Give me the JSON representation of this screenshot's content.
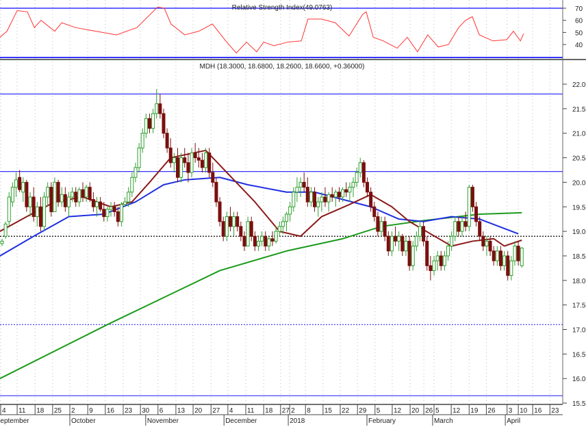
{
  "chart_data": {
    "type": "candlestick",
    "ticker": "MDH",
    "title": "MDH (18.3000, 18.6800, 18.2600, 18.6600, +0.36000)",
    "rsi_title": "Relative Strength Index(49.0763)",
    "ylim": [
      15.5,
      22.0
    ],
    "yticks": [
      "15.5",
      "16.0",
      "16.5",
      "17.0",
      "17.5",
      "18.0",
      "18.5",
      "19.0",
      "19.5",
      "20.0",
      "20.5",
      "21.0",
      "21.5",
      "22.0"
    ],
    "rsi_ylim": [
      30,
      70
    ],
    "rsi_yticks": [
      "40",
      "50",
      "60",
      "70"
    ],
    "rsi_levels": [
      70,
      30
    ],
    "horizontal_lines": [
      {
        "value": 21.8,
        "style": "solid",
        "color": "#3333ff"
      },
      {
        "value": 20.22,
        "style": "solid",
        "color": "#3333ff"
      },
      {
        "value": 17.1,
        "style": "dotted",
        "color": "#3333ff"
      },
      {
        "value": 15.65,
        "style": "solid",
        "color": "#3333ff"
      },
      {
        "value": 18.9,
        "style": "dotted",
        "color": "#000000"
      }
    ],
    "colors": {
      "up": "#2e9e2e",
      "down": "#7a0f0f",
      "ma20": "#8b1a1a",
      "ma50": "#1f2fe0",
      "ma200": "#1a9a1a",
      "rsi": "#ff3333",
      "level": "#3333ff"
    },
    "candles_ohlc": [
      [
        18.75,
        18.85,
        18.7,
        18.8
      ],
      [
        18.9,
        19.2,
        18.85,
        19.15
      ],
      [
        19.2,
        19.8,
        19.1,
        19.7
      ],
      [
        19.6,
        20.0,
        19.5,
        19.9
      ],
      [
        19.9,
        20.2,
        19.7,
        20.05
      ],
      [
        20.1,
        20.25,
        19.8,
        19.85
      ],
      [
        19.8,
        20.1,
        19.6,
        20.0
      ],
      [
        20.0,
        20.05,
        19.4,
        19.5
      ],
      [
        19.5,
        19.8,
        19.3,
        19.7
      ],
      [
        19.7,
        19.9,
        19.2,
        19.3
      ],
      [
        19.3,
        19.6,
        19.1,
        19.5
      ],
      [
        19.5,
        19.7,
        19.0,
        19.1
      ],
      [
        19.1,
        19.8,
        19.0,
        19.7
      ],
      [
        19.7,
        20.0,
        19.5,
        19.9
      ],
      [
        19.9,
        20.0,
        19.3,
        19.4
      ],
      [
        19.4,
        20.1,
        19.4,
        20.0
      ],
      [
        20.0,
        20.05,
        19.5,
        19.6
      ],
      [
        19.6,
        19.9,
        19.5,
        19.75
      ],
      [
        19.75,
        19.9,
        19.4,
        19.5
      ],
      [
        19.5,
        19.8,
        19.3,
        19.7
      ],
      [
        19.7,
        19.9,
        19.6,
        19.8
      ],
      [
        19.8,
        19.9,
        19.5,
        19.6
      ],
      [
        19.6,
        19.9,
        19.5,
        19.85
      ],
      [
        19.85,
        20.0,
        19.6,
        19.7
      ],
      [
        19.7,
        19.95,
        19.6,
        19.9
      ],
      [
        19.9,
        20.0,
        19.6,
        19.65
      ],
      [
        19.65,
        19.8,
        19.4,
        19.5
      ],
      [
        19.5,
        19.7,
        19.3,
        19.6
      ],
      [
        19.6,
        19.7,
        19.4,
        19.45
      ],
      [
        19.45,
        19.6,
        19.2,
        19.3
      ],
      [
        19.3,
        19.5,
        19.2,
        19.45
      ],
      [
        19.45,
        19.6,
        19.3,
        19.5
      ],
      [
        19.5,
        19.6,
        19.3,
        19.4
      ],
      [
        19.4,
        19.5,
        19.1,
        19.2
      ],
      [
        19.2,
        19.6,
        19.1,
        19.55
      ],
      [
        19.55,
        19.7,
        19.5,
        19.6
      ],
      [
        19.6,
        19.9,
        19.5,
        19.8
      ],
      [
        19.8,
        20.2,
        19.7,
        20.1
      ],
      [
        20.1,
        20.4,
        20.0,
        20.3
      ],
      [
        20.3,
        20.8,
        20.2,
        20.7
      ],
      [
        20.7,
        21.1,
        20.6,
        21.0
      ],
      [
        21.0,
        21.4,
        20.9,
        21.3
      ],
      [
        21.3,
        21.4,
        21.0,
        21.1
      ],
      [
        21.1,
        21.5,
        21.0,
        21.4
      ],
      [
        21.4,
        21.9,
        21.3,
        21.6
      ],
      [
        21.6,
        21.8,
        21.3,
        21.4
      ],
      [
        21.4,
        21.5,
        20.9,
        21.0
      ],
      [
        21.0,
        21.1,
        20.6,
        20.7
      ],
      [
        20.7,
        20.9,
        20.3,
        20.4
      ],
      [
        20.4,
        20.6,
        20.2,
        20.5
      ],
      [
        20.5,
        20.7,
        20.0,
        20.1
      ],
      [
        20.1,
        20.6,
        20.0,
        20.5
      ],
      [
        20.5,
        20.7,
        20.3,
        20.4
      ],
      [
        20.4,
        20.6,
        20.0,
        20.2
      ],
      [
        20.2,
        20.7,
        20.1,
        20.6
      ],
      [
        20.6,
        20.8,
        20.4,
        20.5
      ],
      [
        20.5,
        20.7,
        20.3,
        20.45
      ],
      [
        20.45,
        20.6,
        20.2,
        20.3
      ],
      [
        20.3,
        20.7,
        20.2,
        20.6
      ],
      [
        20.6,
        20.7,
        20.1,
        20.2
      ],
      [
        20.2,
        20.4,
        19.9,
        20.0
      ],
      [
        20.0,
        20.1,
        19.5,
        19.6
      ],
      [
        19.6,
        19.7,
        19.1,
        19.2
      ],
      [
        19.2,
        19.3,
        18.8,
        18.9
      ],
      [
        18.9,
        19.4,
        18.8,
        19.3
      ],
      [
        19.3,
        19.5,
        19.0,
        19.1
      ],
      [
        19.1,
        19.4,
        18.9,
        19.3
      ],
      [
        19.3,
        19.4,
        19.0,
        19.1
      ],
      [
        19.1,
        19.2,
        18.8,
        18.9
      ],
      [
        18.9,
        19.0,
        18.6,
        18.7
      ],
      [
        18.7,
        19.3,
        18.7,
        19.2
      ],
      [
        19.2,
        19.3,
        18.8,
        18.9
      ],
      [
        18.9,
        19.0,
        18.6,
        18.7
      ],
      [
        18.7,
        18.9,
        18.6,
        18.8
      ],
      [
        18.8,
        19.0,
        18.7,
        18.9
      ],
      [
        18.9,
        19.0,
        18.6,
        18.7
      ],
      [
        18.7,
        18.9,
        18.6,
        18.85
      ],
      [
        18.85,
        19.0,
        18.7,
        18.8
      ],
      [
        18.8,
        19.1,
        18.75,
        19.0
      ],
      [
        19.0,
        19.2,
        18.9,
        19.1
      ],
      [
        19.1,
        19.3,
        18.95,
        19.2
      ],
      [
        19.2,
        19.4,
        19.0,
        19.35
      ],
      [
        19.35,
        19.6,
        19.2,
        19.5
      ],
      [
        19.5,
        19.9,
        19.4,
        19.8
      ],
      [
        19.8,
        20.1,
        19.6,
        19.9
      ],
      [
        19.9,
        20.1,
        19.7,
        20.0
      ],
      [
        20.0,
        20.2,
        19.8,
        19.9
      ],
      [
        19.9,
        20.1,
        19.5,
        19.6
      ],
      [
        19.6,
        19.9,
        19.5,
        19.8
      ],
      [
        19.8,
        19.9,
        19.4,
        19.5
      ],
      [
        19.5,
        19.7,
        19.3,
        19.6
      ],
      [
        19.6,
        19.8,
        19.4,
        19.7
      ],
      [
        19.7,
        19.9,
        19.5,
        19.6
      ],
      [
        19.6,
        19.8,
        19.4,
        19.75
      ],
      [
        19.75,
        19.9,
        19.6,
        19.7
      ],
      [
        19.7,
        19.85,
        19.5,
        19.8
      ],
      [
        19.8,
        19.9,
        19.6,
        19.7
      ],
      [
        19.7,
        19.9,
        19.6,
        19.85
      ],
      [
        19.85,
        20.0,
        19.7,
        19.8
      ],
      [
        19.8,
        20.0,
        19.6,
        19.9
      ],
      [
        19.9,
        20.1,
        19.7,
        20.0
      ],
      [
        20.0,
        20.3,
        19.9,
        20.2
      ],
      [
        20.2,
        20.5,
        20.1,
        20.4
      ],
      [
        20.4,
        20.45,
        19.9,
        20.0
      ],
      [
        20.0,
        20.1,
        19.7,
        19.8
      ],
      [
        19.8,
        19.9,
        19.4,
        19.5
      ],
      [
        19.5,
        19.6,
        19.2,
        19.3
      ],
      [
        19.3,
        19.4,
        18.9,
        19.0
      ],
      [
        19.0,
        19.3,
        18.9,
        19.2
      ],
      [
        19.2,
        19.3,
        18.8,
        18.9
      ],
      [
        18.9,
        19.0,
        18.5,
        18.6
      ],
      [
        18.6,
        19.0,
        18.5,
        18.9
      ],
      [
        18.9,
        19.1,
        18.7,
        18.8
      ],
      [
        18.8,
        19.0,
        18.6,
        18.9
      ],
      [
        18.9,
        18.95,
        18.5,
        18.6
      ],
      [
        18.6,
        18.9,
        18.5,
        18.8
      ],
      [
        18.8,
        18.9,
        18.2,
        18.3
      ],
      [
        18.3,
        18.8,
        18.2,
        18.7
      ],
      [
        18.7,
        19.0,
        18.6,
        18.9
      ],
      [
        18.9,
        19.2,
        18.8,
        19.1
      ],
      [
        19.1,
        19.2,
        18.7,
        18.8
      ],
      [
        18.8,
        18.9,
        18.2,
        18.3
      ],
      [
        18.3,
        18.5,
        18.0,
        18.2
      ],
      [
        18.2,
        18.5,
        18.1,
        18.4
      ],
      [
        18.4,
        18.6,
        18.2,
        18.5
      ],
      [
        18.5,
        18.6,
        18.2,
        18.3
      ],
      [
        18.3,
        18.6,
        18.2,
        18.5
      ],
      [
        18.5,
        18.8,
        18.4,
        18.7
      ],
      [
        18.7,
        19.0,
        18.6,
        18.9
      ],
      [
        18.9,
        19.3,
        18.8,
        19.2
      ],
      [
        19.2,
        19.3,
        18.9,
        19.0
      ],
      [
        19.0,
        19.3,
        18.9,
        19.2
      ],
      [
        19.2,
        19.4,
        19.0,
        19.1
      ],
      [
        19.1,
        19.95,
        19.0,
        19.9
      ],
      [
        19.9,
        19.95,
        19.4,
        19.5
      ],
      [
        19.5,
        19.6,
        19.1,
        19.2
      ],
      [
        19.2,
        19.3,
        18.8,
        18.9
      ],
      [
        18.9,
        19.0,
        18.6,
        18.7
      ],
      [
        18.7,
        18.9,
        18.5,
        18.8
      ],
      [
        18.8,
        18.9,
        18.5,
        18.6
      ],
      [
        18.6,
        18.7,
        18.3,
        18.4
      ],
      [
        18.4,
        18.7,
        18.3,
        18.6
      ],
      [
        18.6,
        18.7,
        18.2,
        18.3
      ],
      [
        18.3,
        18.6,
        18.2,
        18.5
      ],
      [
        18.5,
        18.6,
        18.0,
        18.1
      ],
      [
        18.1,
        18.5,
        18.0,
        18.4
      ],
      [
        18.4,
        18.8,
        18.3,
        18.7
      ],
      [
        18.7,
        18.8,
        18.3,
        18.4
      ],
      [
        18.3,
        18.68,
        18.26,
        18.66
      ]
    ],
    "ma200": [
      [
        -0.6,
        16.0
      ],
      [
        30,
        17.1
      ],
      [
        62,
        18.2
      ],
      [
        81,
        18.6
      ],
      [
        97,
        18.85
      ],
      [
        108,
        19.1
      ],
      [
        120,
        19.22
      ],
      [
        136,
        19.35
      ],
      [
        148,
        19.38
      ]
    ],
    "ma50": [
      [
        -0.6,
        18.5
      ],
      [
        9,
        18.9
      ],
      [
        19,
        19.3
      ],
      [
        29,
        19.35
      ],
      [
        38,
        19.6
      ],
      [
        46,
        19.95
      ],
      [
        52,
        20.05
      ],
      [
        62,
        20.1
      ],
      [
        70,
        19.95
      ],
      [
        81,
        19.8
      ],
      [
        89,
        19.8
      ],
      [
        97,
        19.65
      ],
      [
        105,
        19.5
      ],
      [
        113,
        19.25
      ],
      [
        120,
        19.2
      ],
      [
        128,
        19.3
      ],
      [
        136,
        19.25
      ],
      [
        147,
        18.95
      ]
    ],
    "ma20": [
      [
        -0.6,
        19.0
      ],
      [
        7,
        19.3
      ],
      [
        15,
        19.6
      ],
      [
        23,
        19.7
      ],
      [
        31,
        19.5
      ],
      [
        37,
        19.6
      ],
      [
        42,
        20.0
      ],
      [
        48,
        20.5
      ],
      [
        58,
        20.65
      ],
      [
        64,
        20.2
      ],
      [
        72,
        19.6
      ],
      [
        79,
        19.0
      ],
      [
        85,
        18.9
      ],
      [
        91,
        19.3
      ],
      [
        99,
        19.55
      ],
      [
        105,
        19.75
      ],
      [
        111,
        19.5
      ],
      [
        116,
        19.2
      ],
      [
        122,
        18.95
      ],
      [
        128,
        18.7
      ],
      [
        134,
        18.8
      ],
      [
        140,
        18.85
      ],
      [
        143,
        18.7
      ],
      [
        148,
        18.82
      ]
    ],
    "rsi": [
      [
        -0.6,
        46
      ],
      [
        1.4,
        51
      ],
      [
        4.3,
        68
      ],
      [
        7.2,
        67
      ],
      [
        9.2,
        54
      ],
      [
        11.1,
        60
      ],
      [
        15,
        51
      ],
      [
        17,
        58
      ],
      [
        20.9,
        54
      ],
      [
        26.7,
        51
      ],
      [
        32.6,
        48
      ],
      [
        38.4,
        54
      ],
      [
        44.3,
        71
      ],
      [
        46.2,
        70
      ],
      [
        48.1,
        57
      ],
      [
        52,
        48
      ],
      [
        56,
        51
      ],
      [
        59.9,
        57
      ],
      [
        63.7,
        43
      ],
      [
        66.7,
        33
      ],
      [
        69.6,
        42
      ],
      [
        72.5,
        34
      ],
      [
        74.5,
        42
      ],
      [
        77.4,
        39
      ],
      [
        81.3,
        42
      ],
      [
        85.2,
        43
      ],
      [
        87.1,
        61
      ],
      [
        91,
        61
      ],
      [
        94.9,
        58
      ],
      [
        98.8,
        47
      ],
      [
        102.7,
        65
      ],
      [
        103.7,
        67
      ],
      [
        105.7,
        46
      ],
      [
        108.6,
        43
      ],
      [
        112.5,
        37
      ],
      [
        115.4,
        46
      ],
      [
        118.3,
        34
      ],
      [
        121.2,
        48
      ],
      [
        124.2,
        38
      ],
      [
        127.1,
        40
      ],
      [
        130,
        54
      ],
      [
        132,
        60
      ],
      [
        133.9,
        63
      ],
      [
        135.9,
        48
      ],
      [
        139.8,
        43
      ],
      [
        143.7,
        44
      ],
      [
        145.6,
        51
      ],
      [
        147.6,
        43
      ],
      [
        148.5,
        49
      ]
    ],
    "x_ticks": [
      {
        "label": "4",
        "idx": -0.4
      },
      {
        "label": "11",
        "idx": 4.3
      },
      {
        "label": "18",
        "idx": 9.4
      },
      {
        "label": "25",
        "idx": 14.4
      },
      {
        "label": "2",
        "idx": 19.3
      },
      {
        "label": "9",
        "idx": 24.4
      },
      {
        "label": "16",
        "idx": 29.4
      },
      {
        "label": "23",
        "idx": 34.5
      },
      {
        "label": "30",
        "idx": 39.4
      },
      {
        "label": "6",
        "idx": 44.4
      },
      {
        "label": "13",
        "idx": 49.5
      },
      {
        "label": "20",
        "idx": 54.4
      },
      {
        "label": "27",
        "idx": 59.5
      },
      {
        "label": "4",
        "idx": 64.3
      },
      {
        "label": "11",
        "idx": 69.4
      },
      {
        "label": "18",
        "idx": 74.5
      },
      {
        "label": "27",
        "idx": 79.3
      },
      {
        "label": "2",
        "idx": 81.9
      },
      {
        "label": "8",
        "idx": 86.4
      },
      {
        "label": "15",
        "idx": 91.4
      },
      {
        "label": "22",
        "idx": 96.3
      },
      {
        "label": "29",
        "idx": 101.2
      },
      {
        "label": "5",
        "idx": 106.2
      },
      {
        "label": "12",
        "idx": 111.1
      },
      {
        "label": "20",
        "idx": 116.2
      },
      {
        "label": "26",
        "idx": 120.1
      },
      {
        "label": "5",
        "idx": 123.0
      },
      {
        "label": "12",
        "idx": 127.9
      },
      {
        "label": "19",
        "idx": 133.0
      },
      {
        "label": "26",
        "idx": 137.9
      },
      {
        "label": "3",
        "idx": 143.8
      },
      {
        "label": "10",
        "idx": 147.0
      },
      {
        "label": "16",
        "idx": 151.1
      },
      {
        "label": "23",
        "idx": 156.0
      }
    ],
    "x_months": [
      {
        "label": "September",
        "idx": -2.2
      },
      {
        "label": "October",
        "idx": 19.3
      },
      {
        "label": "November",
        "idx": 40.9
      },
      {
        "label": "December",
        "idx": 63.2
      },
      {
        "label": "2018",
        "idx": 81.5
      },
      {
        "label": "February",
        "idx": 103.9
      },
      {
        "label": "March",
        "idx": 122.6
      },
      {
        "label": "April",
        "idx": 143.3
      }
    ]
  }
}
